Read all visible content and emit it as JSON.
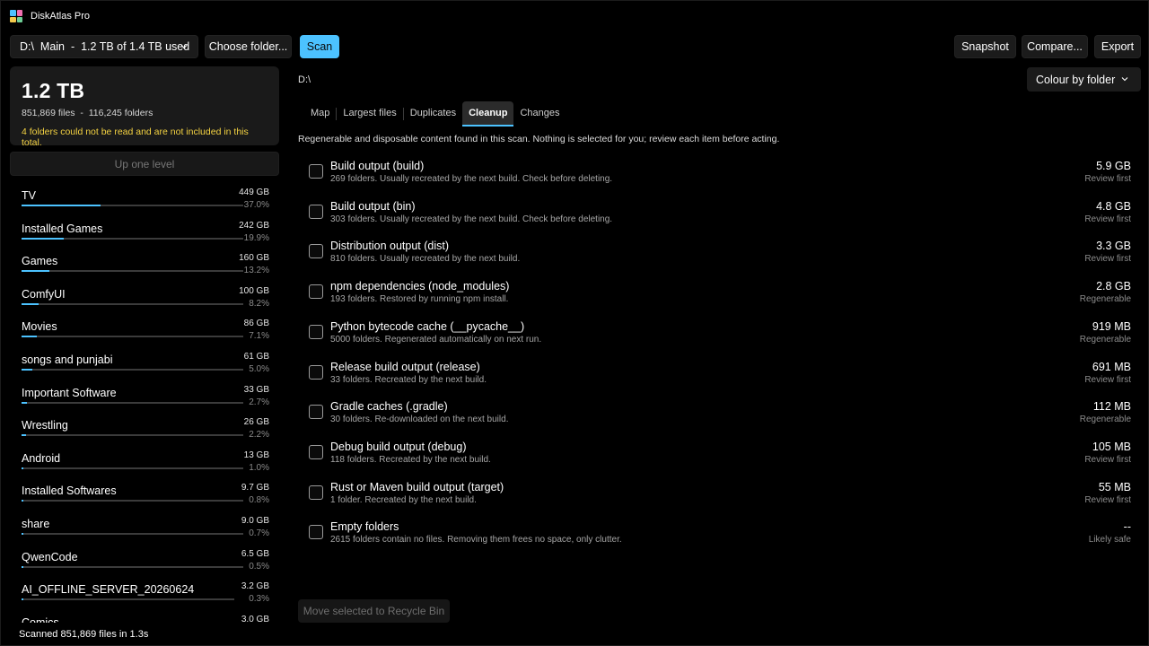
{
  "app": {
    "title": "DiskAtlas Pro",
    "logo_colors": [
      "#4cc2ff",
      "#f06fb0",
      "#f2c94c",
      "#6fcf97"
    ]
  },
  "toolbar": {
    "drive_label": "D:\\  Main  -  1.2 TB of 1.4 TB used",
    "choose_folder_label": "Choose folder...",
    "scan_label": "Scan",
    "snapshot_label": "Snapshot",
    "compare_label": "Compare...",
    "export_label": "Export"
  },
  "summary": {
    "total": "1.2 TB",
    "counts": "851,869 files  -  116,245 folders",
    "warning": "4 folders could not be read and are not included in this total."
  },
  "up_level_label": "Up one level",
  "folders": [
    {
      "name": "TV",
      "size": "449 GB",
      "percent": "37.0%",
      "fraction": 0.37
    },
    {
      "name": "Installed Games",
      "size": "242 GB",
      "percent": "19.9%",
      "fraction": 0.199
    },
    {
      "name": "Games",
      "size": "160 GB",
      "percent": "13.2%",
      "fraction": 0.132
    },
    {
      "name": "ComfyUI",
      "size": "100 GB",
      "percent": "8.2%",
      "fraction": 0.082
    },
    {
      "name": "Movies",
      "size": "86 GB",
      "percent": "7.1%",
      "fraction": 0.071
    },
    {
      "name": "songs and punjabi",
      "size": "61 GB",
      "percent": "5.0%",
      "fraction": 0.05
    },
    {
      "name": "Important Software",
      "size": "33 GB",
      "percent": "2.7%",
      "fraction": 0.027
    },
    {
      "name": "Wrestling",
      "size": "26 GB",
      "percent": "2.2%",
      "fraction": 0.022
    },
    {
      "name": "Android",
      "size": "13 GB",
      "percent": "1.0%",
      "fraction": 0.01
    },
    {
      "name": "Installed Softwares",
      "size": "9.7 GB",
      "percent": "0.8%",
      "fraction": 0.008
    },
    {
      "name": "share",
      "size": "9.0 GB",
      "percent": "0.7%",
      "fraction": 0.007
    },
    {
      "name": "QwenCode",
      "size": "6.5 GB",
      "percent": "0.5%",
      "fraction": 0.005
    },
    {
      "name": "AI_OFFLINE_SERVER_20260624",
      "size": "3.2 GB",
      "percent": "0.3%",
      "fraction": 0.003
    },
    {
      "name": "Comics",
      "size": "3.0 GB",
      "percent": "",
      "fraction": 0.002
    }
  ],
  "status_bar": "Scanned 851,869 files in 1.3s",
  "path": "D:\\",
  "colour_mode_label": "Colour by folder",
  "tabs": [
    {
      "label": "Map",
      "active": false
    },
    {
      "label": "Largest files",
      "active": false
    },
    {
      "label": "Duplicates",
      "active": false
    },
    {
      "label": "Cleanup",
      "active": true
    },
    {
      "label": "Changes",
      "active": false
    }
  ],
  "cleanup": {
    "intro": "Regenerable and disposable content found in this scan. Nothing is selected for you; review each item before acting.",
    "items": [
      {
        "title": "Build output (build)",
        "desc": "269 folders. Usually recreated by the next build. Check before deleting.",
        "size": "5.9 GB",
        "status": "Review first",
        "checked": false
      },
      {
        "title": "Build output (bin)",
        "desc": "303 folders. Usually recreated by the next build. Check before deleting.",
        "size": "4.8 GB",
        "status": "Review first",
        "checked": false
      },
      {
        "title": "Distribution output (dist)",
        "desc": "810 folders. Usually recreated by the next build.",
        "size": "3.3 GB",
        "status": "Review first",
        "checked": false
      },
      {
        "title": "npm dependencies (node_modules)",
        "desc": "193 folders. Restored by running npm install.",
        "size": "2.8 GB",
        "status": "Regenerable",
        "checked": false
      },
      {
        "title": "Python bytecode cache (__pycache__)",
        "desc": "5000 folders. Regenerated automatically on next run.",
        "size": "919 MB",
        "status": "Regenerable",
        "checked": false
      },
      {
        "title": "Release build output (release)",
        "desc": "33 folders. Recreated by the next build.",
        "size": "691 MB",
        "status": "Review first",
        "checked": false
      },
      {
        "title": "Gradle caches (.gradle)",
        "desc": "30 folders. Re-downloaded on the next build.",
        "size": "112 MB",
        "status": "Regenerable",
        "checked": false
      },
      {
        "title": "Debug build output (debug)",
        "desc": "118 folders. Recreated by the next build.",
        "size": "105 MB",
        "status": "Review first",
        "checked": false
      },
      {
        "title": "Rust or Maven build output (target)",
        "desc": "1 folder. Recreated by the next build.",
        "size": "55 MB",
        "status": "Review first",
        "checked": false
      },
      {
        "title": "Empty folders",
        "desc": "2615 folders contain no files. Removing them frees no space, only clutter.",
        "size": "--",
        "status": "Likely safe",
        "checked": false
      }
    ],
    "recycle_label": "Move selected to Recycle Bin"
  }
}
